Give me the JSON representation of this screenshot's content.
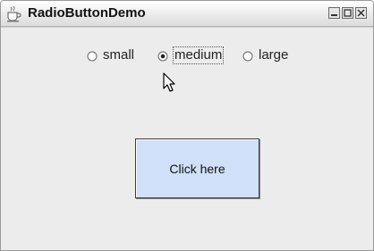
{
  "window": {
    "title": "RadioButtonDemo",
    "controls": [
      "minimize",
      "maximize",
      "close"
    ]
  },
  "radio_group": {
    "options": [
      {
        "label": "small",
        "selected": false
      },
      {
        "label": "medium",
        "selected": true,
        "focused": true
      },
      {
        "label": "large",
        "selected": false
      }
    ]
  },
  "button": {
    "label": "Click here"
  },
  "icons": {
    "app": "java-cup-icon",
    "minimize": "minimize-icon",
    "maximize": "maximize-icon",
    "close": "close-icon",
    "cursor": "mouse-pointer-icon"
  },
  "colors": {
    "button_fill": "#cfe0f8",
    "content_bg": "#ececec"
  }
}
